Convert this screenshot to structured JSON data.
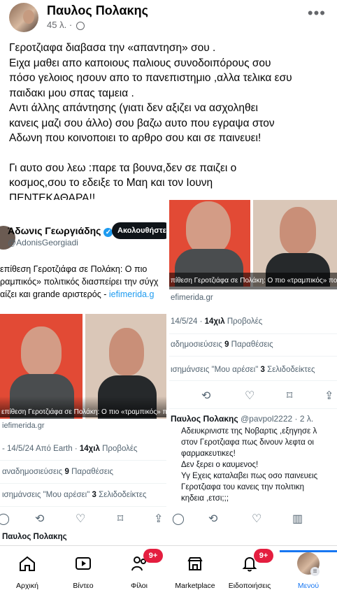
{
  "post": {
    "author": "Παυλος Πολακης",
    "time": "45 λ.",
    "paragraph1": [
      "Γεροτζιαφα διαβασα την «απαντηση» σου .",
      "Ειχα μαθει απο καποιους παλιους συνοδοιπόρους σου",
      "πόσο γελοιος ησουν απο το πανεπιστημιο ,αλλα τελικα εσυ",
      "παιδακι μου σπας ταμεια .",
      "Αντι άλλης απάντησης  (γιατι δεν αξιζει να ασχοληθει",
      "κανεις μαζι σου άλλο) σου βαζω αυτο  που εγραψα στον",
      "Αδωνη που κοινοποιει το αρθρο σου και σε παινευει!"
    ],
    "paragraph2": [
      "Γι αυτο σου λεω :παρε τα βουνα,δεν σε παιζει ο",
      "κοσμος,σου το εδειξε το Μαη και τον Ιουνη",
      "ΠΕΝΤΕΚΑΘΑΡΑ!!"
    ]
  },
  "left_tweet": {
    "name": "Άδωνις Γεωργιάδης",
    "handle": "@AdonisGeorgiadi",
    "follow_label": "Ακολουθήστε",
    "text_lines": [
      "επίθεση Γεροτζιάφα σε Πολάκη: Ο πιο",
      "ραμπικός» πολιτικός διασπείρει την σύγχ",
      "αίζει και grande αριστερός -"
    ],
    "link": "iefimerida.g",
    "caption": "επίθεση Γεροτζιάφα σε Πολάκη: Ο πιο «τραμπικός» πολιτ",
    "source": "iefimerida.gr",
    "stats_time": "- 14/5/24 Από Earth ·",
    "views": "14χιλ",
    "views_label": "Προβολές",
    "reposts_label": "αναδημοσιεύσεις",
    "quotes": "9",
    "quotes_label": "Παραθέσεις",
    "likes_label": "ισημάνσεις \"Μου αρέσει\"",
    "bookmarks": "3",
    "bookmarks_label": "Σελιδοδείκτες"
  },
  "right_tweet": {
    "caption": "πίθεση Γεροτζιάφα σε Πολάκη: Ο πιο «τραμπικός» πολιτικ",
    "source": "efimerida.gr",
    "time": "14/5/24 ·",
    "views": "14χιλ",
    "views_label": "Προβολές",
    "reposts_label": "αδημοσιεύσεις",
    "quotes": "9",
    "quotes_label": "Παραθέσεις",
    "likes_label": "ισημάνσεις \"Μου αρέσει\"",
    "bookmarks": "3",
    "bookmarks_label": "Σελιδοδείκτες",
    "reply_name": "Παυλος Πολακης",
    "reply_handle": "@pavpol2222 · 2 λ.",
    "reply_lines": [
      "Αδειυκρινιστε της Νοβαρτις ,εξηγησε λ",
      "στον Γεροτζιαφα πως δινουν λεφτα οι",
      "φαρμακευτικες!",
      "Δεν ξερει ο καυμενος!",
      "Υγ Εχεις καταλαβει πως οσο παινευεις",
      "Γεροτζιαφα του κανεις την πολιτικη",
      "κηδεια ,ετσι;;;"
    ]
  },
  "nav": {
    "items": [
      {
        "label": "Αρχική",
        "icon": "home-icon"
      },
      {
        "label": "Βίντεο",
        "icon": "video-icon"
      },
      {
        "label": "Φίλοι",
        "icon": "friends-icon",
        "badge": "9+"
      },
      {
        "label": "Marketplace",
        "icon": "marketplace-icon"
      },
      {
        "label": "Ειδοποιήσεις",
        "icon": "bell-icon",
        "badge": "9+"
      },
      {
        "label": "Μενού",
        "icon": "menu-avatar"
      }
    ],
    "selected_color": "#1877f2",
    "badge_color": "#e41e3f"
  }
}
